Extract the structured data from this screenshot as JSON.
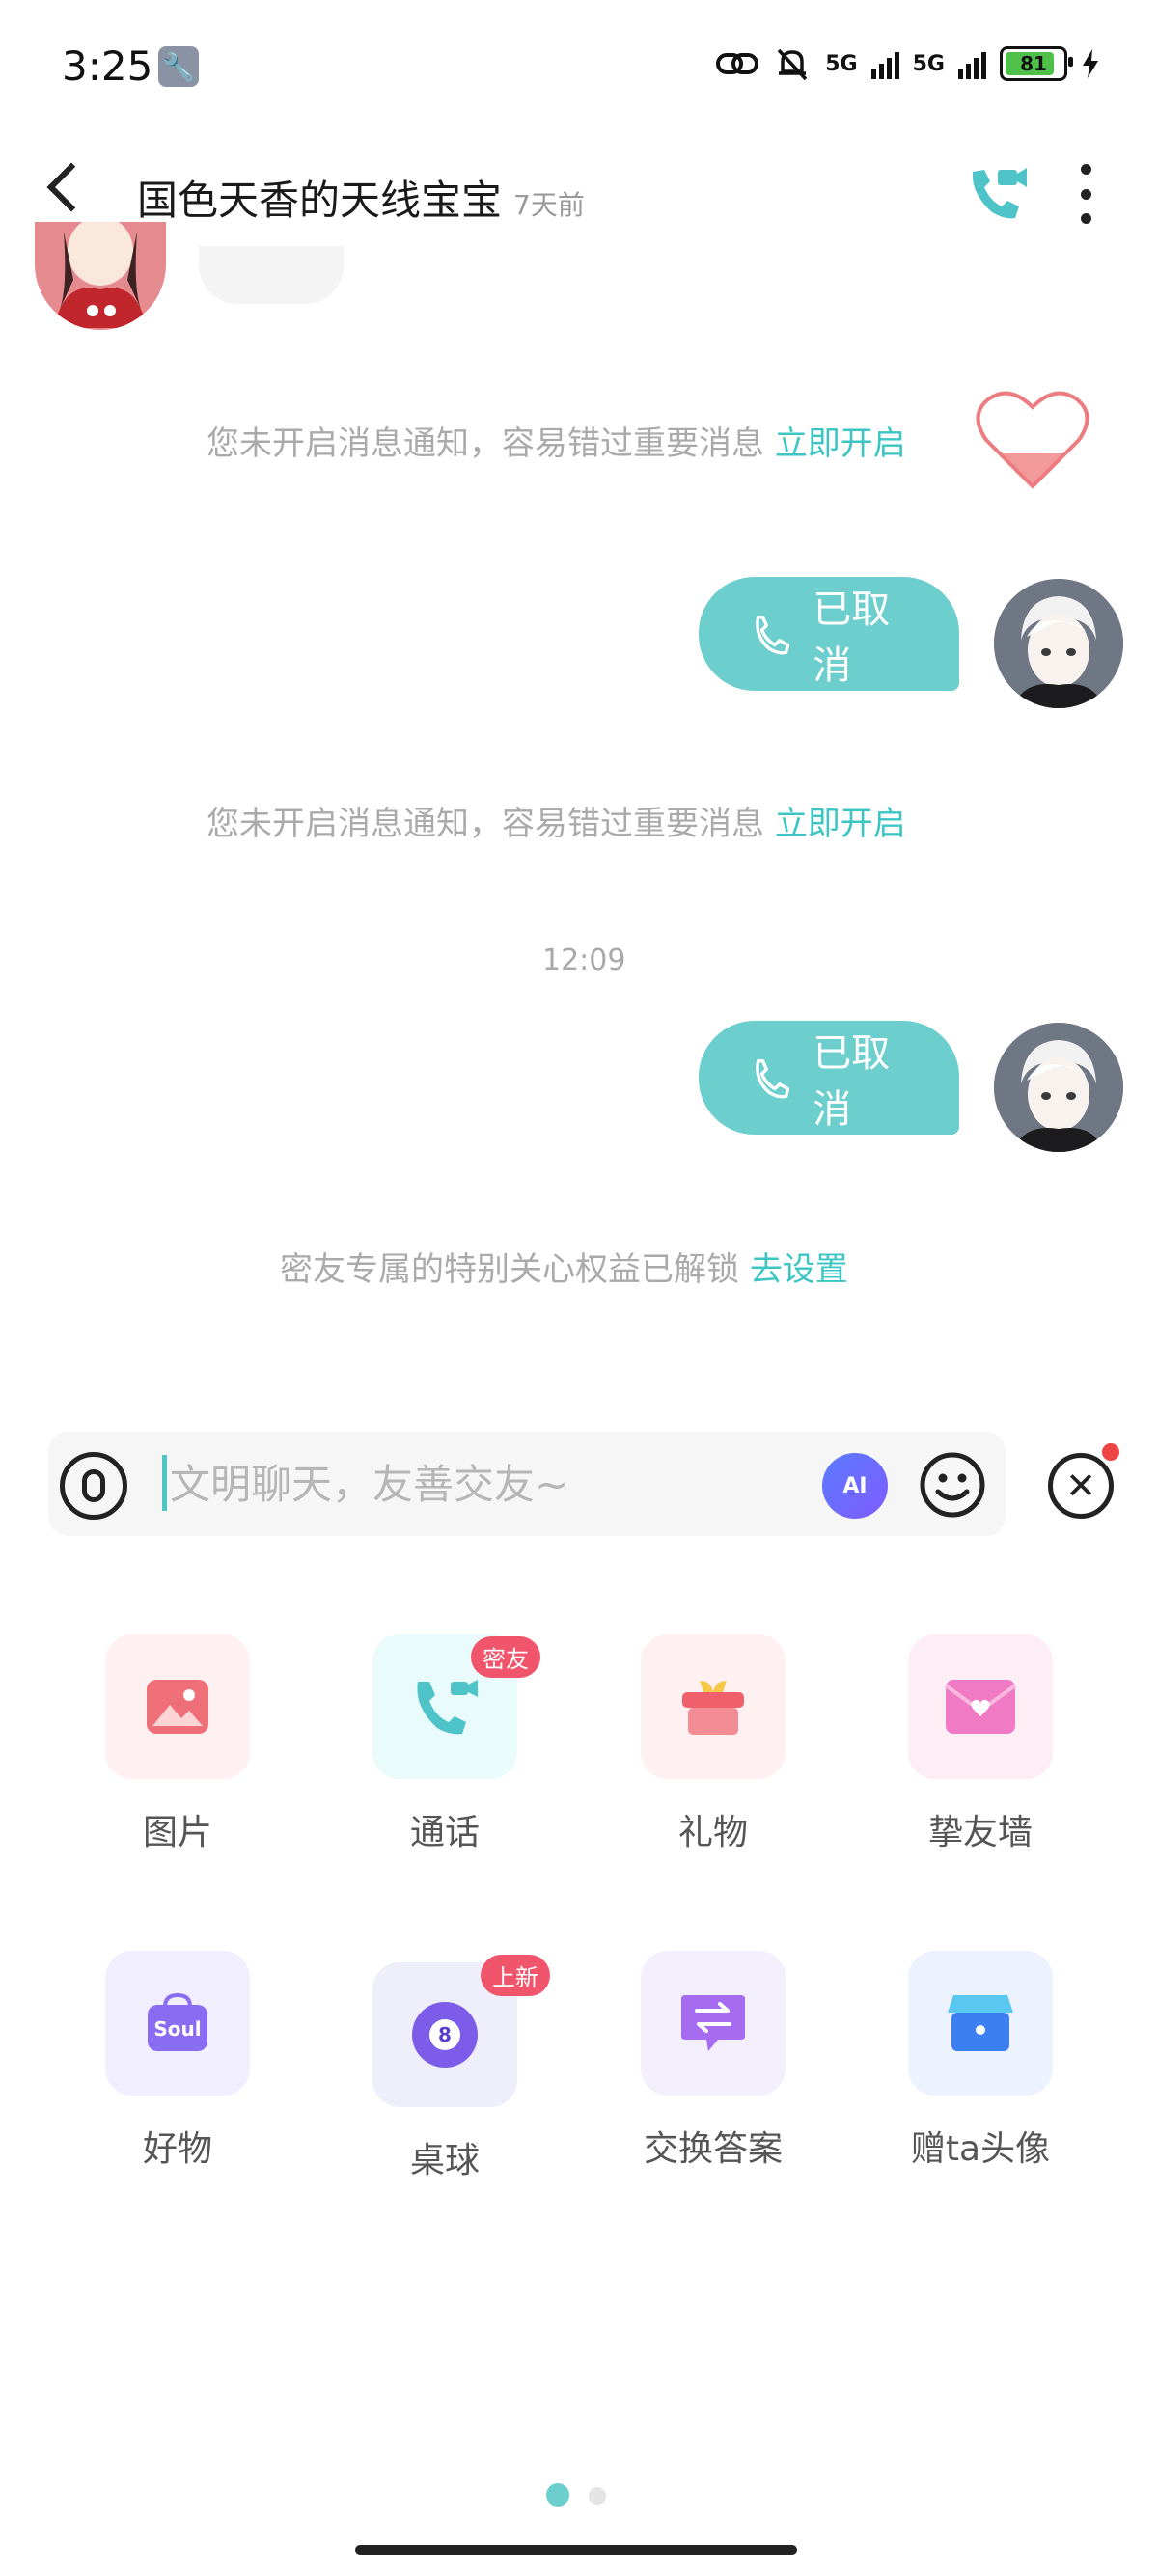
{
  "status_bar": {
    "time": "3:25",
    "network_1": "5G",
    "network_2": "5G",
    "battery": "81"
  },
  "header": {
    "title": "国色天香的天线宝宝",
    "last_seen": "7天前"
  },
  "messages": {
    "notice_1": {
      "text": "您未开启消息通知，容易错过重要消息",
      "link": "立即开启"
    },
    "call_1": "已取消",
    "notice_2": {
      "text": "您未开启消息通知，容易错过重要消息",
      "link": "立即开启"
    },
    "timestamp": "12:09",
    "call_2": "已取消",
    "notice_3": {
      "text": "密友专属的特别关心权益已解锁",
      "link": "去设置"
    }
  },
  "input": {
    "placeholder": "文明聊天，友善交友~",
    "ai_label": "AI"
  },
  "features": [
    {
      "label": "图片",
      "icon": "image-icon"
    },
    {
      "label": "通话",
      "icon": "phone-video-icon",
      "badge": "密友"
    },
    {
      "label": "礼物",
      "icon": "gift-icon"
    },
    {
      "label": "挚友墙",
      "icon": "envelope-heart-icon"
    },
    {
      "label": "好物",
      "icon": "soul-bag-icon",
      "icon_text": "Soul"
    },
    {
      "label": "桌球",
      "icon": "billiard-ball-icon",
      "badge": "上新",
      "icon_text": "8"
    },
    {
      "label": "交换答案",
      "icon": "exchange-icon"
    },
    {
      "label": "赠ta头像",
      "icon": "store-icon"
    }
  ],
  "colors": {
    "accent": "#3cc5c3",
    "bubble": "#6dcfcd",
    "badge": "#f0556c"
  }
}
